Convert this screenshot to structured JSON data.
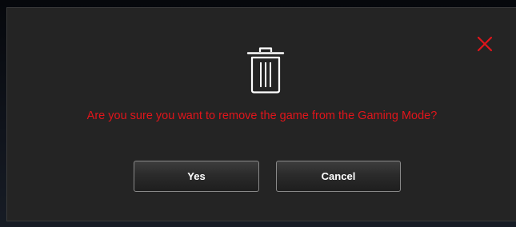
{
  "dialog": {
    "close_icon": "close-icon",
    "trash_icon": "trash-icon",
    "message": "Are you sure you want to remove the game from the Gaming Mode?",
    "buttons": {
      "yes_label": "Yes",
      "cancel_label": "Cancel"
    }
  },
  "colors": {
    "accent_red": "#e0151b",
    "dialog_background": "#242424",
    "button_text": "#ffffff",
    "icon_white": "#ffffff"
  }
}
